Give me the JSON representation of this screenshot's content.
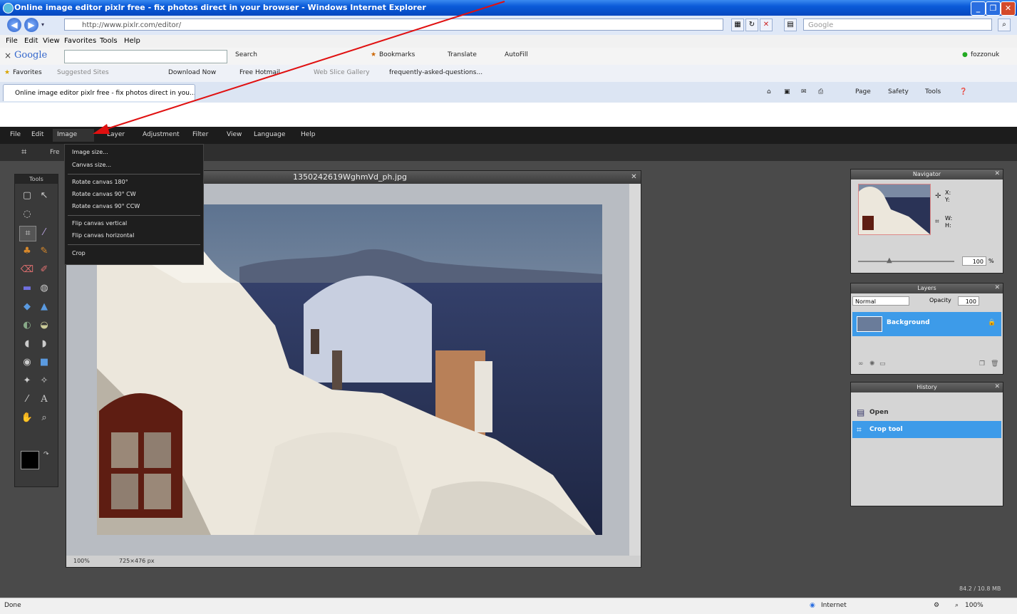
{
  "ie": {
    "window_title": "Online image editor pixlr free - fix photos direct in your browser - Windows Internet Explorer",
    "window_buttons": [
      "_",
      "❐",
      "✕"
    ],
    "address_url": "http://www.pixlr.com/editor/",
    "search_placeholder": "Google",
    "menu": [
      "File",
      "Edit",
      "View",
      "Favorites",
      "Tools",
      "Help"
    ],
    "google_bar": {
      "logo": "Google",
      "search_btn": "Search",
      "bookmarks": "Bookmarks",
      "translate": "Translate",
      "autofill": "AutoFill",
      "account": "fozzonuk"
    },
    "favorites_bar": {
      "favorites": "Favorites",
      "items": [
        "Suggested Sites",
        "Download Now",
        "Free Hotmail",
        "Web Slice Gallery",
        "frequently-asked-questions..."
      ]
    },
    "tab_title": "Online image editor pixlr free - fix photos direct in you...",
    "command_bar": [
      "Page",
      "Safety",
      "Tools"
    ],
    "status_left": "Done",
    "status_zone": "Internet",
    "status_zoom": "100%"
  },
  "pixlr": {
    "menu": [
      "File",
      "Edit",
      "Image",
      "Layer",
      "Adjustment",
      "Filter",
      "View",
      "Language",
      "Help"
    ],
    "options_label": "Fre",
    "image_menu": {
      "group1": [
        "Image size...",
        "Canvas size..."
      ],
      "group2": [
        "Rotate canvas 180°",
        "Rotate canvas 90° CW",
        "Rotate canvas 90° CCW"
      ],
      "group3": [
        "Flip canvas vertical",
        "Flip canvas horizontal"
      ],
      "group4": [
        "Crop"
      ]
    },
    "tools_title": "Tools",
    "text_tool": "A",
    "image_window": {
      "filename": "1350242619WghmVd_ph.jpg",
      "zoom": "100%",
      "size": "725×476 px"
    },
    "navigator": {
      "title": "Navigator",
      "x_label": "X:",
      "y_label": "Y:",
      "w_label": "W:",
      "h_label": "H:",
      "zoom": "100"
    },
    "layers": {
      "title": "Layers",
      "blend_mode": "Normal",
      "opacity_label": "Opacity",
      "opacity": "100",
      "layer_name": "Background"
    },
    "history": {
      "title": "History",
      "items": [
        "Open",
        "Crop tool"
      ]
    },
    "memory": "84.2 / 10.8 MB"
  },
  "colors": {
    "ie_title": "#0a5ad8",
    "pixlr_dark": "#1c1c1c",
    "highlight": "#3d9be9",
    "arrow": "#e01010"
  }
}
